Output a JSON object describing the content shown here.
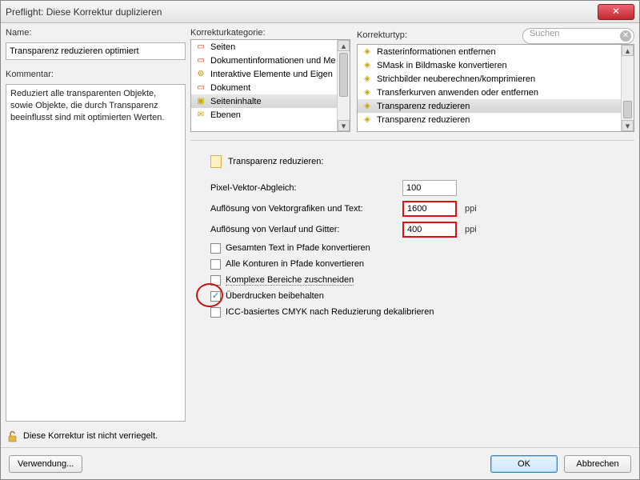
{
  "window": {
    "title": "Preflight: Diese Korrektur duplizieren"
  },
  "left": {
    "name_label": "Name:",
    "name_value": "Transparenz reduzieren optimiert",
    "comment_label": "Kommentar:",
    "comment_value": "Reduziert alle transparenten Objekte, sowie Objekte, die durch Transparenz beeinflusst sind mit optimierten Werten.",
    "lock_text": "Diese Korrektur ist nicht verriegelt."
  },
  "kategorie": {
    "label": "Korrekturkategorie:",
    "items": [
      {
        "icon": "page",
        "text": "Seiten"
      },
      {
        "icon": "doc",
        "text": "Dokumentinformationen und Me"
      },
      {
        "icon": "gear",
        "text": "Interaktive Elemente und Eigen"
      },
      {
        "icon": "page",
        "text": "Dokument"
      },
      {
        "icon": "folder",
        "text": "Seiteninhalte"
      },
      {
        "icon": "env",
        "text": "Ebenen"
      }
    ],
    "selected_index": 4
  },
  "typ": {
    "label": "Korrekturtyp:",
    "search_placeholder": "Suchen",
    "items": [
      {
        "text": "Rasterinformationen entfernen"
      },
      {
        "text": "SMask in Bildmaske konvertieren"
      },
      {
        "text": "Strichbilder neuberechnen/komprimieren"
      },
      {
        "text": "Transferkurven anwenden oder entfernen"
      },
      {
        "text": "Transparenz reduzieren"
      },
      {
        "text": "Transparenz reduzieren"
      }
    ],
    "selected_index": 4
  },
  "details": {
    "header": "Transparenz reduzieren:",
    "pixel_label": "Pixel-Vektor-Abgleich:",
    "pixel_value": "100",
    "vector_label": "Auflösung von Vektorgrafiken und Text:",
    "vector_value": "1600",
    "gradient_label": "Auflösung von Verlauf und Gitter:",
    "gradient_value": "400",
    "ppi": "ppi",
    "chk_text_paths": "Gesamten Text in Pfade konvertieren",
    "chk_stroke_paths": "Alle Konturen in Pfade konvertieren",
    "chk_clip": "Komplexe Bereiche zuschneiden",
    "chk_overprint": "Überdrucken beibehalten",
    "chk_icc": "ICC-basiertes CMYK nach Reduzierung dekalibrieren"
  },
  "footer": {
    "usage": "Verwendung...",
    "ok": "OK",
    "cancel": "Abbrechen"
  }
}
